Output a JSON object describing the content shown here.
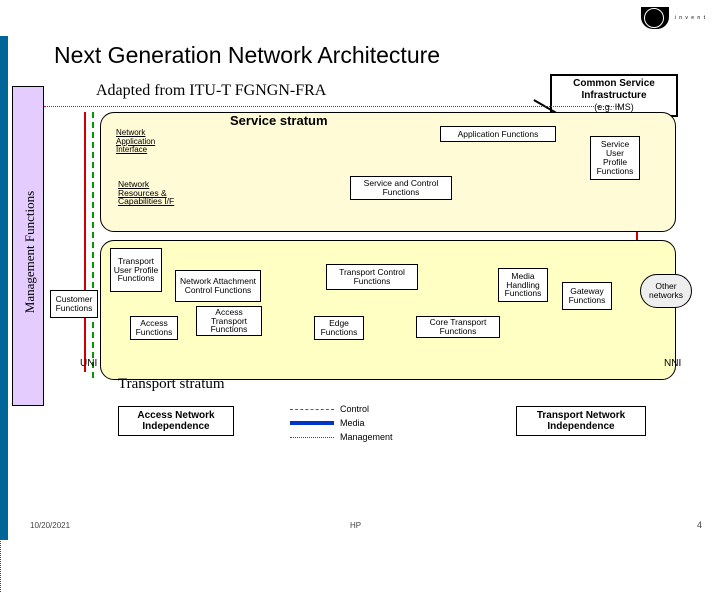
{
  "header": {
    "hp_invent": "i n v e n t"
  },
  "title": "Next Generation Network Architecture",
  "subtitle": "Adapted from ITU-T FGNGN-FRA",
  "csi": {
    "line1": "Common Service Infrastructure",
    "line2": "(e.g. IMS)"
  },
  "management_functions": "Management Functions",
  "service_stratum": {
    "title": "Service stratum",
    "nai_underlined": "Network",
    "nai_rest": "Application Interface",
    "app_functions": "Application Functions",
    "sup": "Service User Profile Functions",
    "nrc_underlined": "Network",
    "nrc_rest": "Resources & Capabilities I/F",
    "scf": "Service and Control Functions"
  },
  "transport_stratum": {
    "title": "Transport stratum",
    "tup": "Transport User Profile Functions",
    "nac": "Network Attachment Control Functions",
    "tcf": "Transport Control Functions",
    "mhf": "Media Handling Functions",
    "gwf": "Gateway Functions",
    "onw": "Other networks",
    "cf": "Customer Functions",
    "acf": "Access Functions",
    "atf": "Access Transport Functions",
    "edf": "Edge Functions",
    "ctf": "Core Transport Functions"
  },
  "uni": "UNI",
  "nni": "NNI",
  "ani": "Access Network Independence",
  "tni": "Transport Network Independence",
  "legend": {
    "control": "Control",
    "media": "Media",
    "mgmt": "Management"
  },
  "footer": {
    "date": "10/20/2021",
    "center": "HP",
    "page": "4"
  }
}
